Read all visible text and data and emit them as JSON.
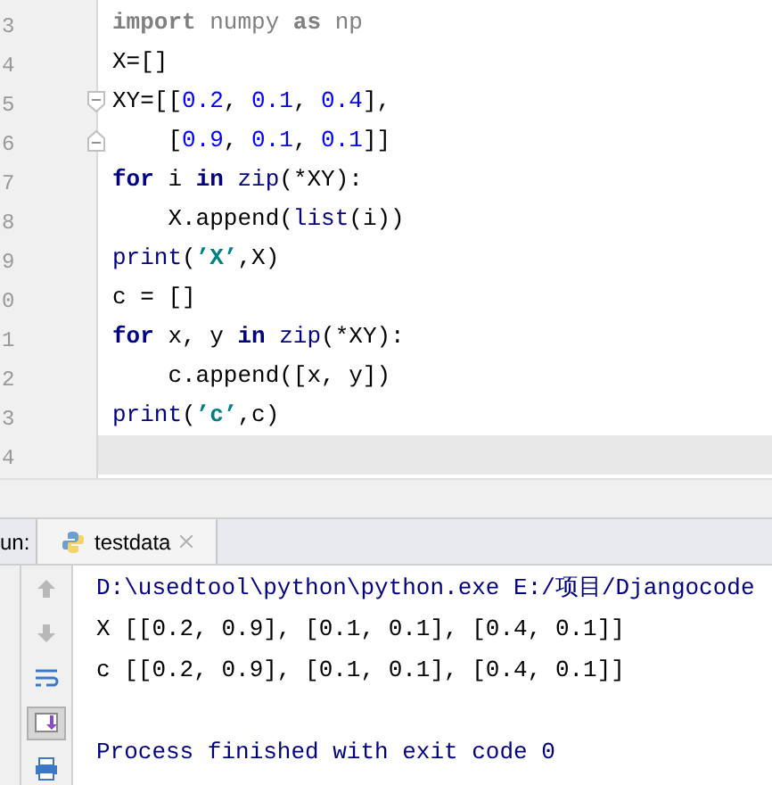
{
  "editor": {
    "lines": [
      {
        "number": "3",
        "current": false,
        "kind": "code",
        "tokens": [
          {
            "kind": "unused_keyword",
            "text": "import"
          },
          {
            "kind": "unused",
            "text": " numpy "
          },
          {
            "kind": "unused_keyword",
            "text": "as"
          },
          {
            "kind": "unused",
            "text": " np"
          }
        ]
      },
      {
        "number": "4",
        "current": false,
        "kind": "code",
        "tokens": [
          {
            "kind": "plain",
            "text": "X=[]"
          }
        ]
      },
      {
        "number": "5",
        "current": false,
        "kind": "fold_start",
        "tokens": [
          {
            "kind": "plain",
            "text": "XY=[["
          },
          {
            "kind": "number",
            "text": "0.2"
          },
          {
            "kind": "plain",
            "text": ", "
          },
          {
            "kind": "number",
            "text": "0.1"
          },
          {
            "kind": "plain",
            "text": ", "
          },
          {
            "kind": "number",
            "text": "0.4"
          },
          {
            "kind": "plain",
            "text": "],"
          }
        ]
      },
      {
        "number": "6",
        "current": false,
        "kind": "fold_end",
        "tokens": [
          {
            "kind": "plain",
            "text": "    ["
          },
          {
            "kind": "number",
            "text": "0.9"
          },
          {
            "kind": "plain",
            "text": ", "
          },
          {
            "kind": "number",
            "text": "0.1"
          },
          {
            "kind": "plain",
            "text": ", "
          },
          {
            "kind": "number",
            "text": "0.1"
          },
          {
            "kind": "plain",
            "text": "]]"
          }
        ]
      },
      {
        "number": "7",
        "current": false,
        "kind": "code",
        "tokens": [
          {
            "kind": "keyword",
            "text": "for"
          },
          {
            "kind": "plain",
            "text": " i "
          },
          {
            "kind": "keyword",
            "text": "in"
          },
          {
            "kind": "builtin",
            "text": " zip"
          },
          {
            "kind": "plain",
            "text": "(*XY):"
          }
        ]
      },
      {
        "number": "8",
        "current": false,
        "kind": "code",
        "tokens": [
          {
            "kind": "plain",
            "text": "    X.append("
          },
          {
            "kind": "builtin",
            "text": "list"
          },
          {
            "kind": "plain",
            "text": "(i))"
          }
        ]
      },
      {
        "number": "9",
        "current": false,
        "kind": "code",
        "tokens": [
          {
            "kind": "builtin",
            "text": "print"
          },
          {
            "kind": "plain",
            "text": "("
          },
          {
            "kind": "string",
            "text": "’X’"
          },
          {
            "kind": "plain",
            "text": ",X)"
          }
        ]
      },
      {
        "number": "0",
        "current": false,
        "kind": "code",
        "tokens": [
          {
            "kind": "plain",
            "text": "c = []"
          }
        ]
      },
      {
        "number": "1",
        "current": false,
        "kind": "code",
        "tokens": [
          {
            "kind": "keyword",
            "text": "for"
          },
          {
            "kind": "plain",
            "text": " x, y "
          },
          {
            "kind": "keyword",
            "text": "in"
          },
          {
            "kind": "builtin",
            "text": " zip"
          },
          {
            "kind": "plain",
            "text": "(*XY):"
          }
        ]
      },
      {
        "number": "2",
        "current": false,
        "kind": "code",
        "tokens": [
          {
            "kind": "plain",
            "text": "    c.append([x, y])"
          }
        ]
      },
      {
        "number": "3",
        "current": false,
        "kind": "code",
        "tokens": [
          {
            "kind": "builtin",
            "text": "print"
          },
          {
            "kind": "plain",
            "text": "("
          },
          {
            "kind": "string",
            "text": "’c’"
          },
          {
            "kind": "plain",
            "text": ",c)"
          }
        ]
      },
      {
        "number": "4",
        "current": true,
        "kind": "code"
      }
    ]
  },
  "run": {
    "label": "un:",
    "tab": {
      "title": "testdata",
      "selected": true
    },
    "tools": [
      {
        "kind": "up",
        "selected": false
      },
      {
        "kind": "down",
        "selected": false
      },
      {
        "kind": "wrap",
        "selected": false
      },
      {
        "kind": "scroll",
        "selected": true
      },
      {
        "kind": "print",
        "selected": false
      }
    ],
    "output": [
      {
        "kind": "command",
        "text": "D:\\usedtool\\python\\python.exe E:/项目/Djangocode"
      },
      {
        "kind": "stdout",
        "text": "X [[0.2, 0.9], [0.1, 0.1], [0.4, 0.1]]"
      },
      {
        "kind": "stdout",
        "text": "c [[0.2, 0.9], [0.1, 0.1], [0.4, 0.1]]"
      },
      {
        "kind": "system",
        "text": "Process finished with exit code 0"
      }
    ]
  }
}
